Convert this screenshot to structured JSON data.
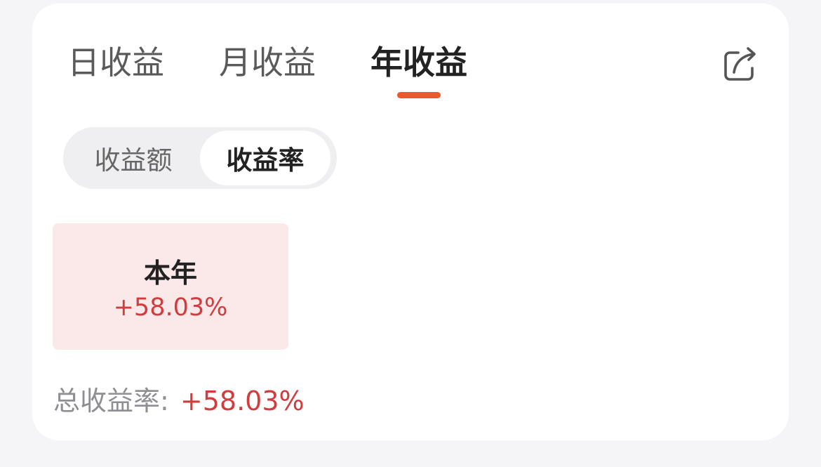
{
  "tabs": [
    {
      "label": "日收益",
      "active": false
    },
    {
      "label": "月收益",
      "active": false
    },
    {
      "label": "年收益",
      "active": true
    }
  ],
  "share_icon": "share-icon",
  "segment": {
    "left_label": "收益额",
    "right_label": "收益率",
    "selected": "收益率"
  },
  "year_card": {
    "title": "本年",
    "value": "+58.03%"
  },
  "total": {
    "label": "总收益率:",
    "value": "+58.03%"
  },
  "colors": {
    "accent": "#e8592c",
    "positive": "#d23c3c",
    "highlight_bg": "#fbe8e8",
    "background": "#f5f5f7"
  }
}
